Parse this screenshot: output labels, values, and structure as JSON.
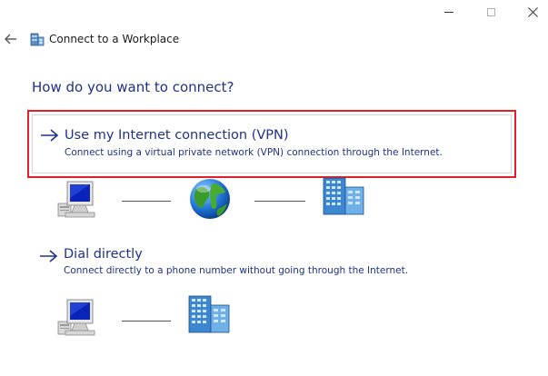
{
  "window": {
    "title": "Connect to a Workplace",
    "controls": {
      "minimize": "minimize",
      "maximize": "maximize",
      "close": "close"
    }
  },
  "page": {
    "heading": "How do you want to connect?"
  },
  "options": [
    {
      "title": "Use my Internet connection (VPN)",
      "description": "Connect using a virtual private network (VPN) connection through the Internet.",
      "selected": true,
      "diagram": [
        "computer-icon",
        "internet-globe-icon",
        "workplace-building-icon"
      ]
    },
    {
      "title": "Dial directly",
      "description": "Connect directly to a phone number without going through the Internet.",
      "selected": false,
      "diagram": [
        "computer-icon",
        "workplace-building-icon"
      ]
    }
  ],
  "colors": {
    "link_blue": "#1e3287",
    "highlight_red": "#e3202a",
    "option_border": "#d6d6d6"
  }
}
